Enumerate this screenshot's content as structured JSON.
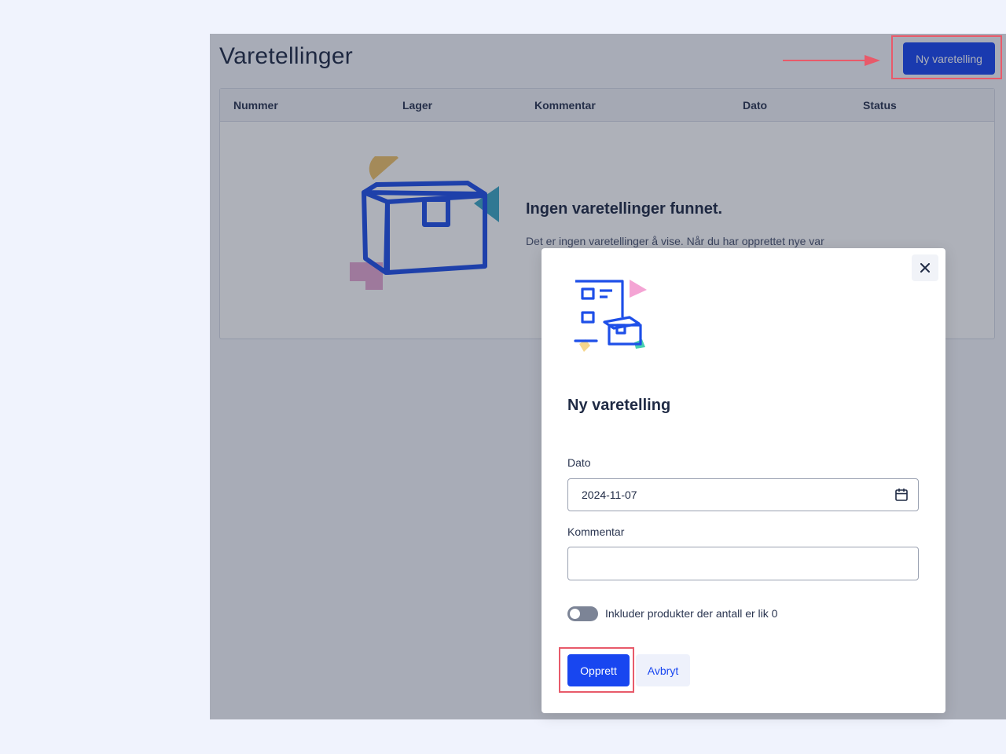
{
  "page": {
    "title": "Varetellinger",
    "new_button_label": "Ny varetelling"
  },
  "table": {
    "columns": [
      "Nummer",
      "Lager",
      "Kommentar",
      "Dato",
      "Status"
    ],
    "empty_title": "Ingen varetellinger funnet.",
    "empty_text": "Det er ingen varetellinger å vise. Når du har opprettet nye var"
  },
  "modal": {
    "title": "Ny varetelling",
    "close_icon": "close-icon",
    "date_label": "Dato",
    "date_value": "2024-11-07",
    "comment_label": "Kommentar",
    "comment_value": "",
    "toggle_label": "Inkluder produkter der antall er lik 0",
    "toggle_on": false,
    "create_label": "Opprett",
    "cancel_label": "Avbryt"
  },
  "colors": {
    "accent": "#1846f0",
    "annotation": "#e85a6a",
    "overlay": "#1f263c"
  }
}
